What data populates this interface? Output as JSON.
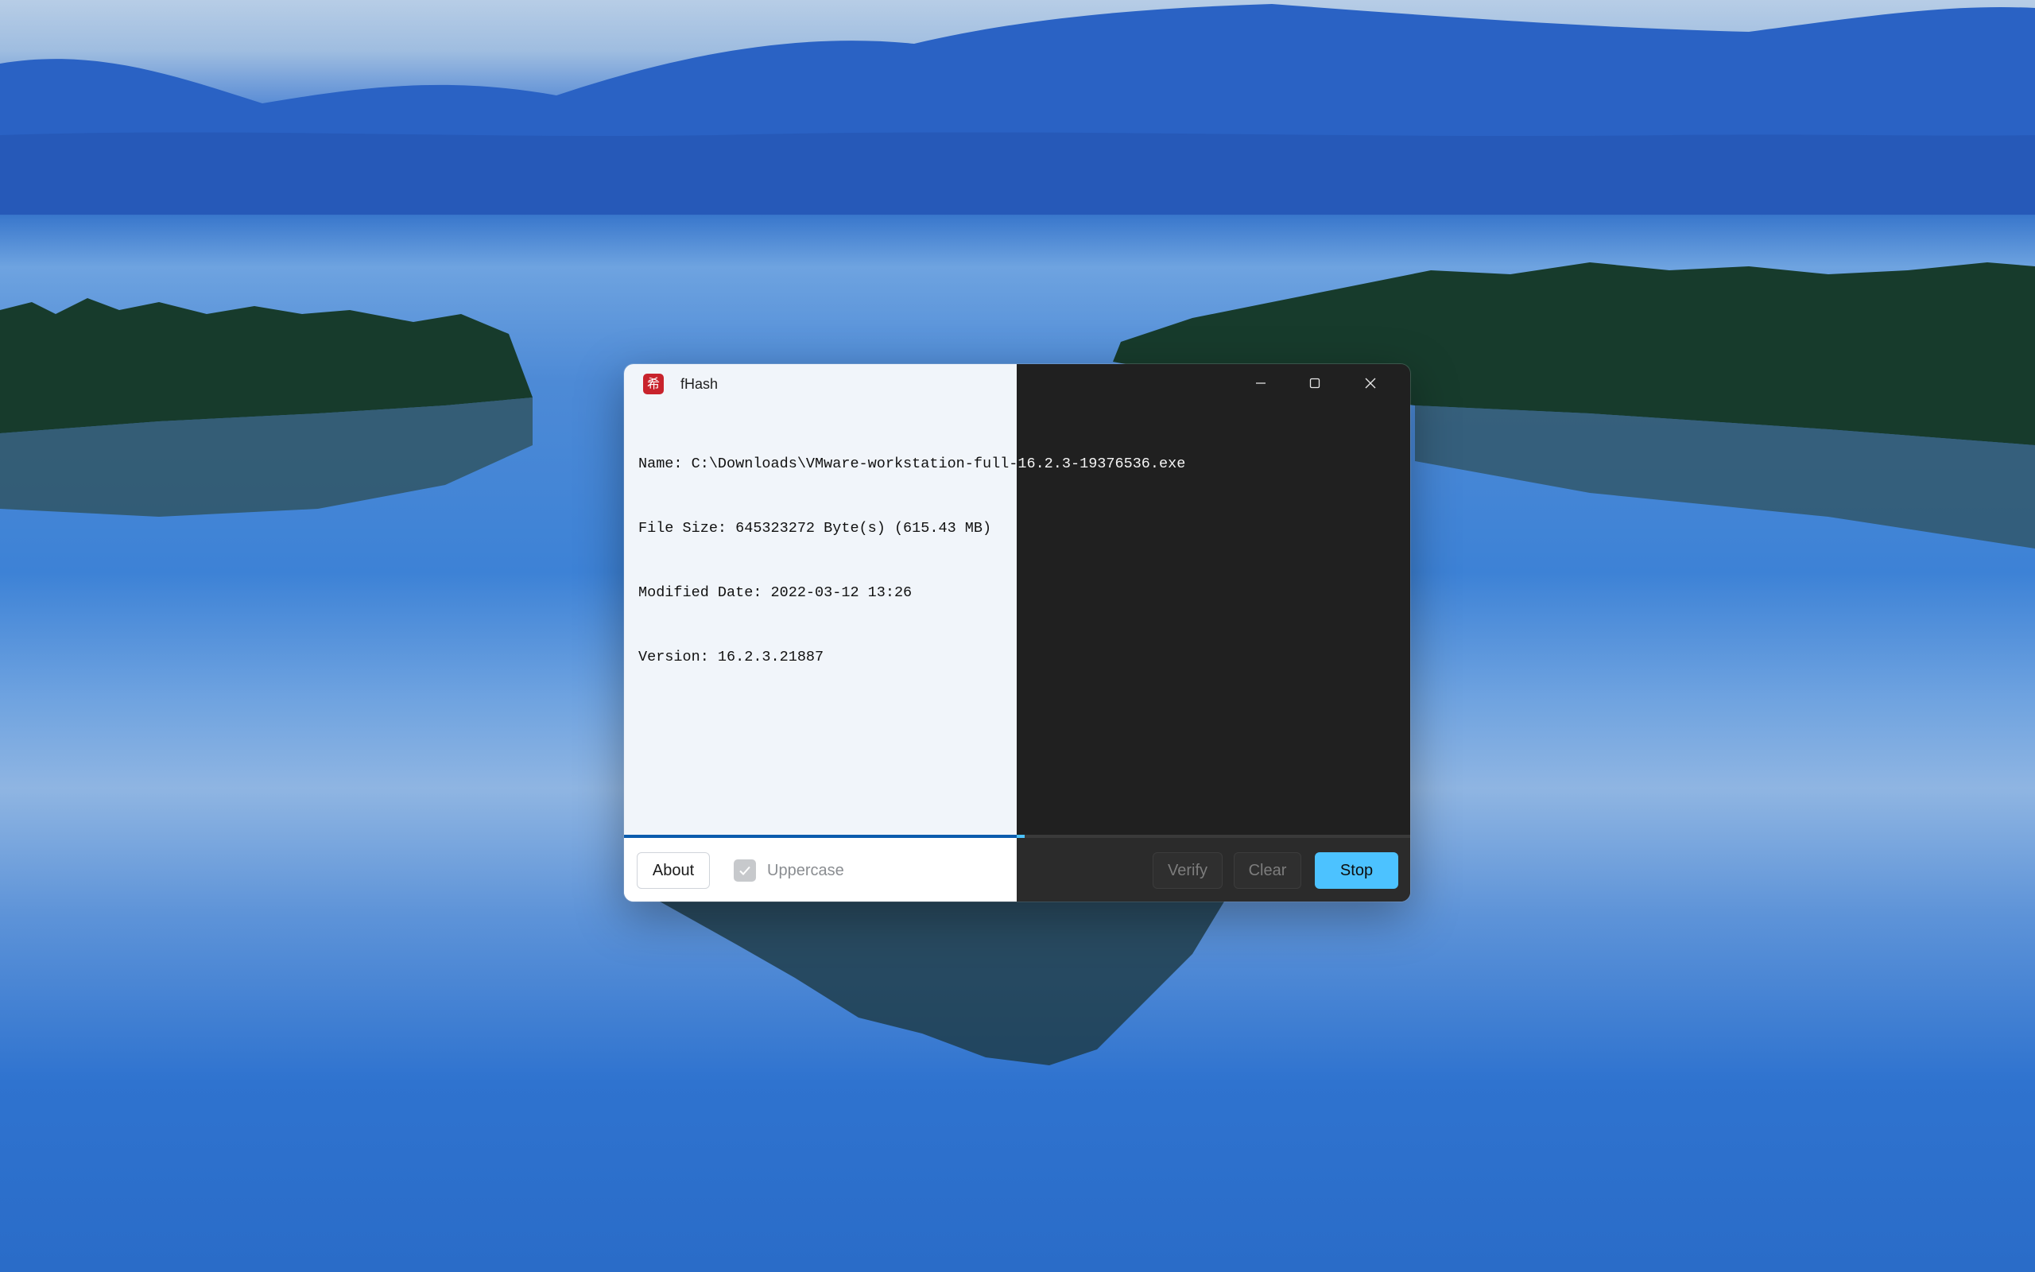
{
  "window": {
    "title": "fHash",
    "icon_glyph": "希",
    "icon_color": "#c8232c"
  },
  "output": {
    "lines": [
      "Name: C:\\Downloads\\VMware-workstation-full-16.2.3-19376536.exe",
      "File Size: 645323272 Byte(s) (615.43 MB)",
      "Modified Date: 2022-03-12 13:26",
      "Version: 16.2.3.21887"
    ]
  },
  "progress": {
    "value": 0.51,
    "accent_light": "#0b5cad",
    "accent_dark": "#4cc2ff"
  },
  "footer": {
    "about_label": "About",
    "uppercase_label": "Uppercase",
    "uppercase_checked": true,
    "uppercase_enabled": false,
    "verify_label": "Verify",
    "clear_label": "Clear",
    "stop_label": "Stop"
  },
  "icons": {
    "minimize": "minimize-icon",
    "maximize": "maximize-icon",
    "close": "close-icon",
    "check": "check-icon"
  }
}
